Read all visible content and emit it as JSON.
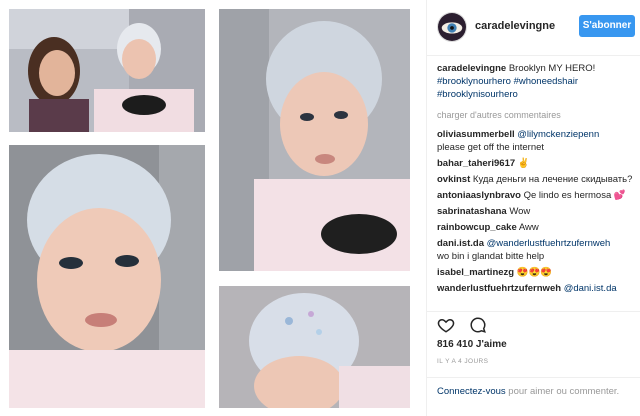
{
  "post": {
    "username": "caradelevingne",
    "follow_label": "S'abonner",
    "caption": {
      "username": "caradelevingne",
      "text": "Brooklyn MY HERO!",
      "hashtags": [
        "#brooklynourhero",
        "#whoneedshair",
        "#brooklynisourhero"
      ]
    },
    "load_more": "charger d'autres commentaires",
    "comments": [
      {
        "user": "oliviasummerbell",
        "mention": "@lilymckenziepenn",
        "text": "please get off the internet"
      },
      {
        "user": "bahar_taheri9617",
        "mention": "",
        "text": "✌"
      },
      {
        "user": "ovkinst",
        "mention": "",
        "text": "Куда деньги на лечение скидывать?"
      },
      {
        "user": "antoniaaslynbravo",
        "mention": "",
        "text": "Qe lindo es hermosa 💕"
      },
      {
        "user": "sabrinatashana",
        "mention": "",
        "text": "Wow"
      },
      {
        "user": "rainbowcup_cake",
        "mention": "",
        "text": "Aww"
      },
      {
        "user": "dani.ist.da",
        "mention": "@wanderlustfuehrtzufernweh",
        "text": "wo bin i glandat bitte help"
      },
      {
        "user": "isabel_martinezg",
        "mention": "",
        "text": "😍😍😍"
      },
      {
        "user": "wanderlustfuehrtzufernweh",
        "mention": "@dani.ist.da",
        "text": ""
      }
    ],
    "likes": "816 410 J'aime",
    "time": "IL Y A 4 JOURS",
    "login_link": "Connectez-vous",
    "login_text": " pour aimer ou commenter."
  },
  "icons": {
    "like": "heart-icon",
    "comment": "comment-icon",
    "avatar": "avatar-image"
  },
  "colors": {
    "follow_button": "#3897f0",
    "link": "#003569",
    "muted": "#999999",
    "text": "#262626"
  }
}
